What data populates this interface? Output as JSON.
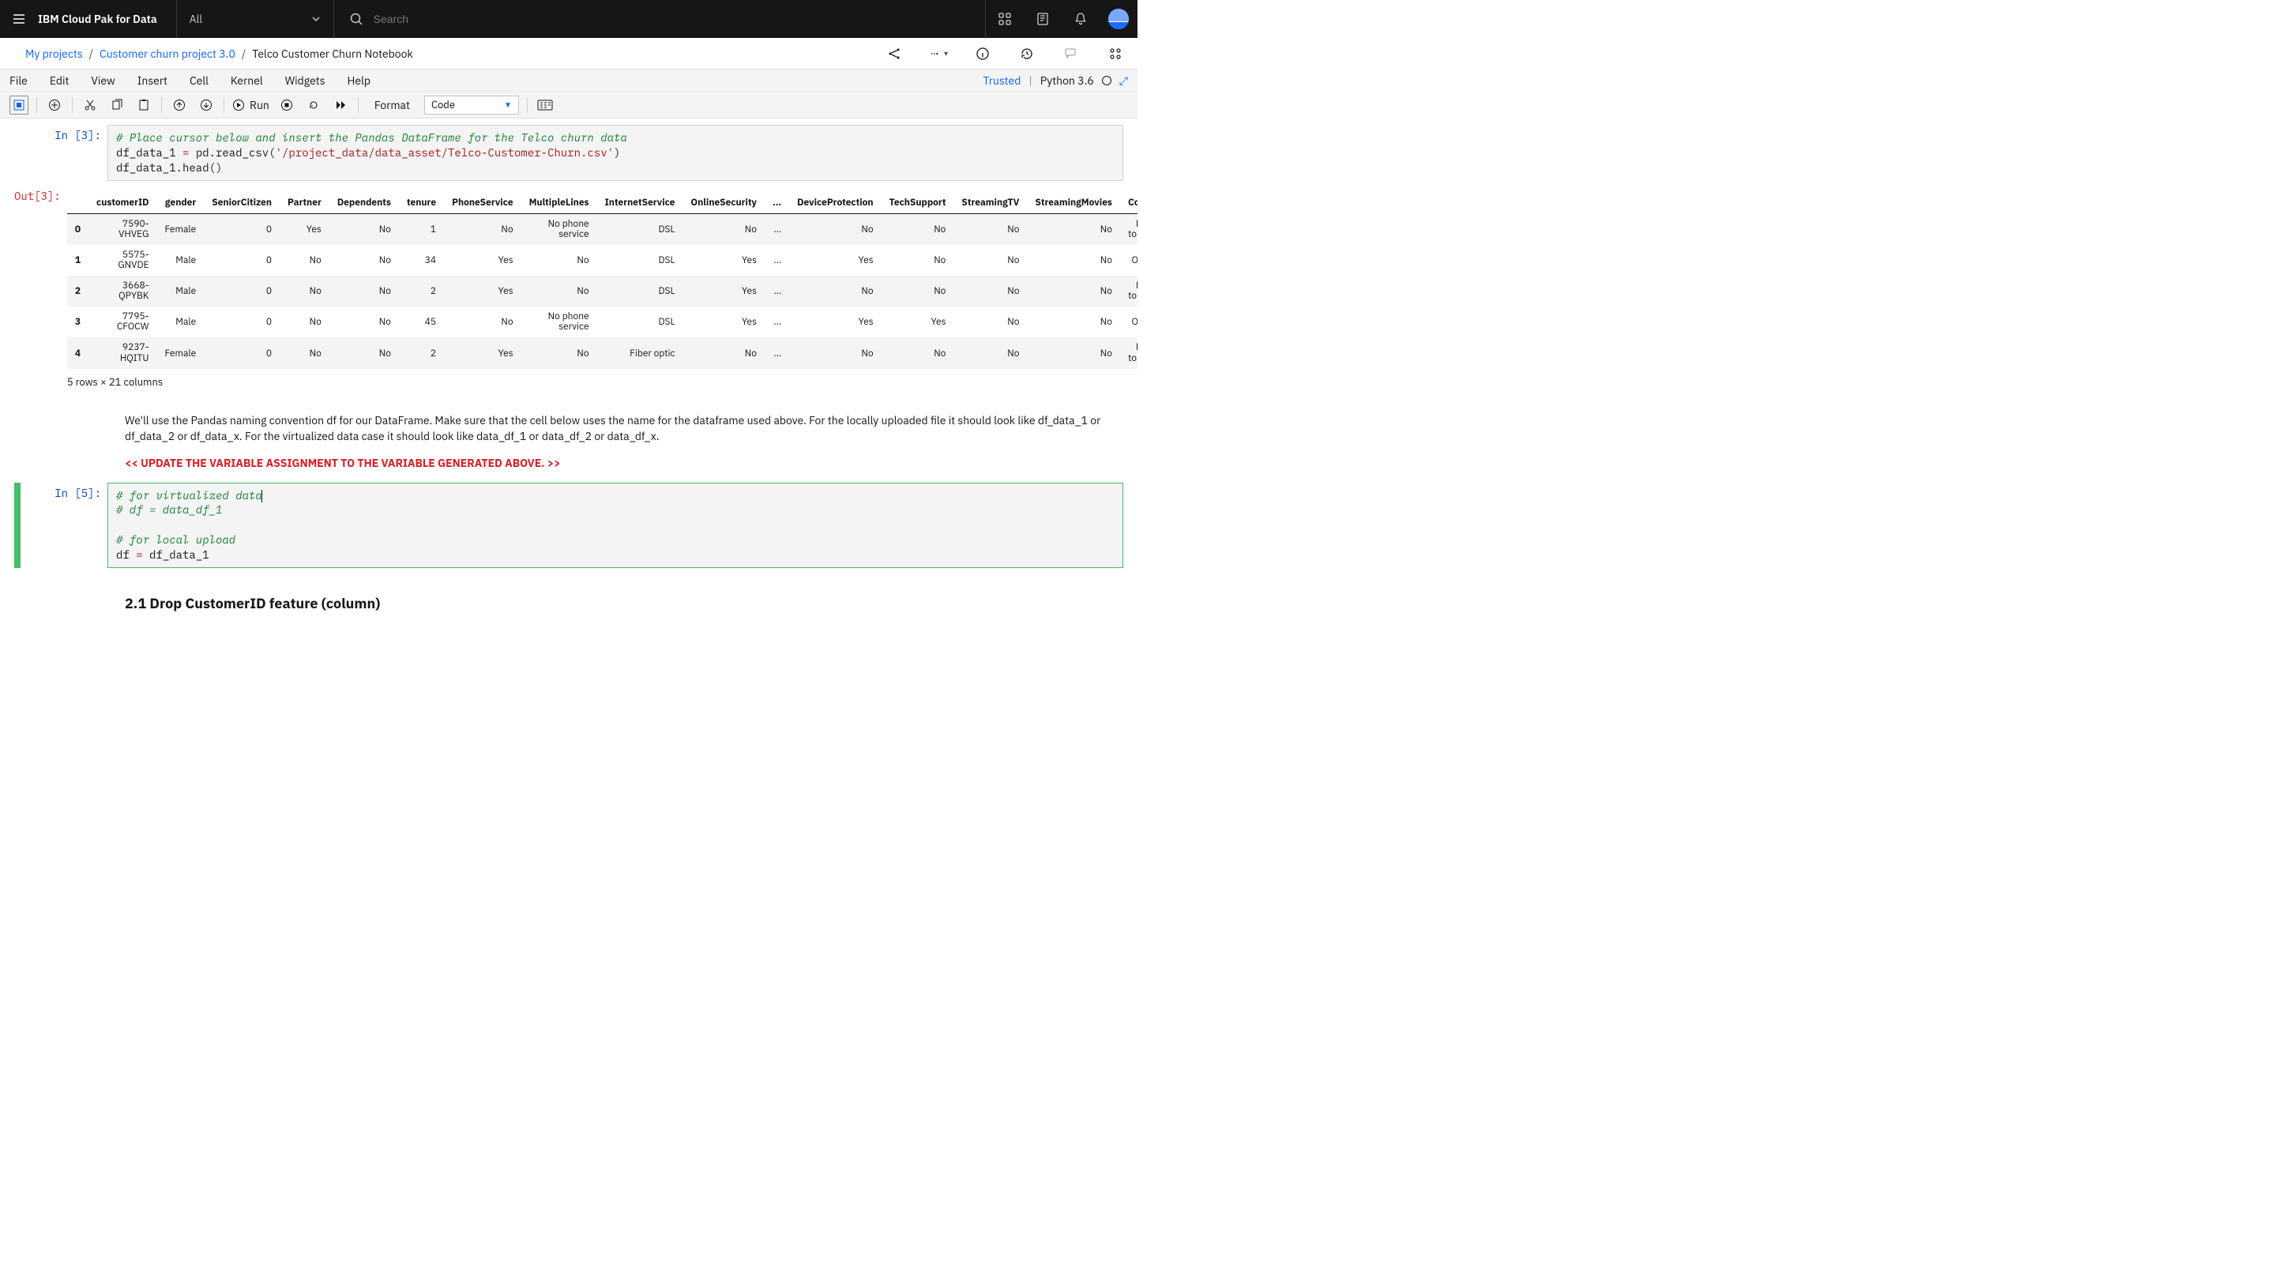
{
  "header": {
    "brand": "IBM Cloud Pak for Data",
    "scope": "All",
    "search_placeholder": "Search"
  },
  "breadcrumb": {
    "root": "My projects",
    "project": "Customer churn project 3.0",
    "current": "Telco Customer Churn Notebook"
  },
  "menubar": {
    "items": [
      "File",
      "Edit",
      "View",
      "Insert",
      "Cell",
      "Kernel",
      "Widgets",
      "Help"
    ],
    "trusted": "Trusted",
    "kernel": "Python 3.6"
  },
  "toolbar": {
    "run": "Run",
    "format": "Format",
    "cell_type": "Code"
  },
  "cell_in3": {
    "prompt": "In [3]:",
    "comment": "# Place cursor below and insert the Pandas DataFrame for the Telco churn data",
    "line2_pre": "df_data_1 ",
    "line2_eq": "= ",
    "line2_rest": "pd.read_csv(",
    "line2_str": "'/project_data/data_asset/Telco-Customer-Churn.csv'",
    "line2_close": ")",
    "line3": "df_data_1.head()"
  },
  "out3": {
    "prompt": "Out[3]:",
    "headers": [
      "customerID",
      "gender",
      "SeniorCitizen",
      "Partner",
      "Dependents",
      "tenure",
      "PhoneService",
      "MultipleLines",
      "InternetService",
      "OnlineSecurity",
      "...",
      "DeviceProtection",
      "TechSupport",
      "StreamingTV",
      "StreamingMovies",
      "Cont"
    ],
    "rows": [
      {
        "idx": "0",
        "cells": [
          "7590-VHVEG",
          "Female",
          "0",
          "Yes",
          "No",
          "1",
          "No",
          "No phone service",
          "DSL",
          "No",
          "...",
          "No",
          "No",
          "No",
          "No",
          "Mo to-m"
        ]
      },
      {
        "idx": "1",
        "cells": [
          "5575-GNVDE",
          "Male",
          "0",
          "No",
          "No",
          "34",
          "Yes",
          "No",
          "DSL",
          "Yes",
          "...",
          "Yes",
          "No",
          "No",
          "No",
          "One"
        ]
      },
      {
        "idx": "2",
        "cells": [
          "3668-QPYBK",
          "Male",
          "0",
          "No",
          "No",
          "2",
          "Yes",
          "No",
          "DSL",
          "Yes",
          "...",
          "No",
          "No",
          "No",
          "No",
          "Mo to-m"
        ]
      },
      {
        "idx": "3",
        "cells": [
          "7795-CFOCW",
          "Male",
          "0",
          "No",
          "No",
          "45",
          "No",
          "No phone service",
          "DSL",
          "Yes",
          "...",
          "Yes",
          "Yes",
          "No",
          "No",
          "One"
        ]
      },
      {
        "idx": "4",
        "cells": [
          "9237-HQITU",
          "Female",
          "0",
          "No",
          "No",
          "2",
          "Yes",
          "No",
          "Fiber optic",
          "No",
          "...",
          "No",
          "No",
          "No",
          "No",
          "Mo to-m"
        ]
      }
    ],
    "caption": "5 rows × 21 columns"
  },
  "markdown1": {
    "p": "We'll use the Pandas naming convention df for our DataFrame. Make sure that the cell below uses the name for the dataframe used above. For the locally uploaded file it should look like df_data_1 or df_data_2 or df_data_x. For the virtualized data case it should look like data_df_1 or data_df_2 or data_df_x.",
    "red": "<< UPDATE THE VARIABLE ASSIGNMENT TO THE VARIABLE GENERATED ABOVE. >>"
  },
  "cell_in5": {
    "prompt": "In [5]:",
    "l1": "# for virtualized data",
    "l2": "# df = data_df_1",
    "l3": "# for local upload",
    "l4a": "df ",
    "l4eq": "= ",
    "l4b": "df_data_1"
  },
  "section_h": "2.1 Drop CustomerID feature (column)"
}
